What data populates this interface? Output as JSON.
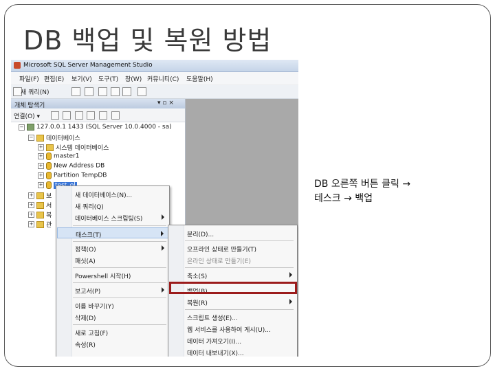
{
  "slide": {
    "title": "DB 백업 및 복원 방법",
    "caption_line1": "DB 오른쪽 버튼 클릭 →",
    "caption_line2": "테스크 → 백업"
  },
  "window": {
    "title": "Microsoft SQL Server Management Studio"
  },
  "menubar": [
    "파일(F)",
    "편집(E)",
    "보기(V)",
    "도구(T)",
    "창(W)",
    "커뮤니티(C)",
    "도움말(H)"
  ],
  "toolbar": {
    "new_query": "새 쿼리(N)"
  },
  "explorer": {
    "title": "개체 탐색기",
    "pin": "▾ ▫ ×",
    "connect": "연결(O) ▾",
    "tree": {
      "server": "127.0.0.1 1433 (SQL Server 10.0.4000 - sa)",
      "databases": "데이터베이스",
      "system_db": "시스템 데이터베이스",
      "db1": "master1",
      "db2": "New Address DB",
      "db3": "Partition TempDB",
      "db4": "test_ol",
      "f1": "보",
      "f2": "서",
      "f3": "복",
      "f4": "관"
    }
  },
  "context_menu": {
    "items": [
      "새 데이터베이스(N)...",
      "새 쿼리(Q)",
      "데이터베이스 스크립팅(S)",
      "태스크(T)",
      "정책(O)",
      "패싯(A)",
      "Powershell 시작(H)",
      "보고서(P)",
      "이름 바꾸기(Y)",
      "삭제(D)",
      "새로 고침(F)",
      "속성(R)"
    ]
  },
  "tasks_submenu": {
    "items": [
      "분리(D)...",
      "오프라인 상태로 만들기(T)",
      "온라인 상태로 만들기(E)",
      "축소(S)",
      "백업(B)...",
      "복원(R)",
      "스크립트 생성(E)...",
      "웹 서비스를 사용하여 게시(U)...",
      "데이터 가져오기(I)...",
      "데이터 내보내기(X)..."
    ]
  },
  "colors": {
    "highlight_border": "#9b1b1b",
    "selection": "#3875d7",
    "workspace": "#a9a9a9"
  }
}
